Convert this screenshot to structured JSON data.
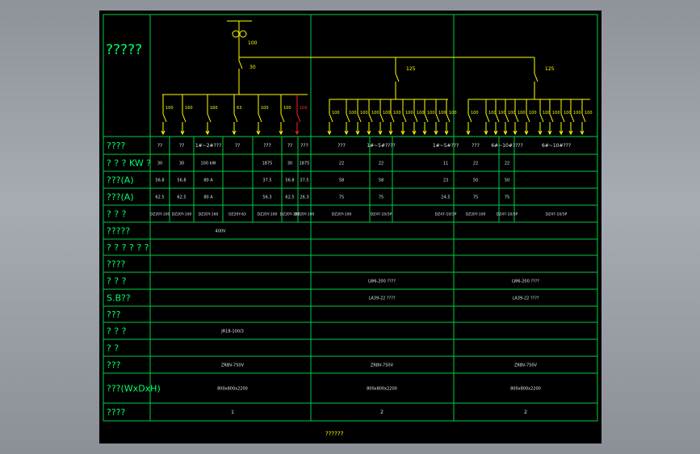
{
  "row_labels": [
    "????",
    "? ? ? KW ?",
    "???(A)",
    "???(A)",
    "? ? ?",
    "?????",
    "? ? ? ? ? ?",
    "????",
    "? ? ?",
    "S.B??",
    "???",
    "? ? ?",
    "? ?",
    "???",
    "???(WxDxH)",
    "????"
  ],
  "title_label": "?????",
  "breaker_labels": {
    "main": "30",
    "sec1": "125",
    "sec2": "125",
    "top": "100"
  },
  "sec0_branch_labels": [
    "100",
    "160",
    "160",
    "63",
    "100",
    "100",
    "100"
  ],
  "sec1_branch_labels": [
    "100",
    "100",
    "100",
    "100",
    "100",
    "100",
    "100",
    "100",
    "100",
    "100",
    "100",
    "100"
  ],
  "sec2_branch_labels": [
    "100",
    "100",
    "100",
    "100",
    "100",
    "100",
    "100",
    "100",
    "100",
    "100",
    "100",
    "100"
  ],
  "table": {
    "name_row": [
      "??",
      "??",
      "1#~2#???",
      "??",
      "???",
      "??",
      "???",
      "???",
      "1#~5#????",
      "1#~5#???",
      "???",
      "6#~10#????",
      "6#~10#???"
    ],
    "kw_row": [
      "30",
      "30",
      "100 kW",
      "",
      "1875",
      "30",
      "1875",
      "22",
      "22",
      "11",
      "22",
      "22"
    ],
    "amp1_row": [
      "56.8",
      "56.8",
      "80 A",
      "",
      "37.5",
      "56.8",
      "37.5",
      "58",
      "58",
      "23",
      "50",
      "50"
    ],
    "amp2_row": [
      "62.5",
      "62.5",
      "80 A",
      "",
      "56.3",
      "62.5",
      "26.3",
      "75",
      "75",
      "24.5",
      "75",
      "75"
    ],
    "model_row": [
      "DZ20Y-100",
      "DZ20Y-100",
      "DZ20Y-160",
      "DZ20Y-63",
      "DZ20Y-100",
      "DZ20Y-100",
      "DZ20Y-100",
      "DZ20Y-100",
      "DZ47-10/3P",
      "DZ47-10/3P",
      "DZ20Y-100",
      "DZ47-10/3P",
      "DZ47-10/3P"
    ],
    "row6_text": "400V",
    "row9_mid": "LW6-200 ????",
    "row9_right": "LW6-200 ????",
    "row10_mid": "LA39-22 ????",
    "row10_right": "LA39-22 ????",
    "row12_text": "JR18-100/3",
    "row14": [
      "ZRBV-750V",
      "ZRBV-750V",
      "ZRBV-750V"
    ],
    "row15": [
      "800x800x2200",
      "800x800x2200",
      "800x800x2200"
    ],
    "row16": [
      "1",
      "2",
      "2"
    ]
  },
  "footer": "??????"
}
